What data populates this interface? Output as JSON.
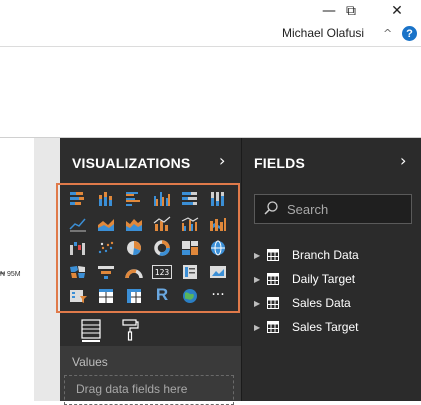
{
  "window": {
    "minimize_glyph": "—",
    "restore_glyph": "⧉",
    "close_glyph": "✕"
  },
  "account": {
    "user_name": "Michael Olafusi",
    "collapse_glyph": "^",
    "help_glyph": "?"
  },
  "canvas": {
    "value_label": "₦ 95M"
  },
  "visualizations": {
    "title": "VISUALIZATIONS",
    "expand_glyph": "›",
    "icons": [
      "stacked-bar-chart-icon",
      "stacked-column-chart-icon",
      "clustered-bar-chart-icon",
      "clustered-column-chart-icon",
      "100-stacked-bar-chart-icon",
      "100-stacked-column-chart-icon",
      "line-chart-icon",
      "area-chart-icon",
      "stacked-area-chart-icon",
      "line-and-stacked-column-chart-icon",
      "line-and-clustered-column-chart-icon",
      "ribbon-chart-icon",
      "waterfall-chart-icon",
      "scatter-chart-icon",
      "pie-chart-icon",
      "donut-chart-icon",
      "treemap-icon",
      "map-icon",
      "filled-map-icon",
      "funnel-icon",
      "gauge-icon",
      "card-icon",
      "multi-row-card-icon",
      "kpi-icon",
      "slicer-icon",
      "table-icon",
      "matrix-icon",
      "r-script-visual-icon",
      "arcgis-map-icon",
      "more-visuals-icon"
    ],
    "r_label": "R",
    "more_label": "···",
    "card_label": "123",
    "tabs": [
      "fields-tab-icon",
      "format-paint-roller-icon"
    ],
    "values_label": "Values",
    "drop_placeholder": "Drag data fields here",
    "accent_color": "#e07a4a"
  },
  "fields": {
    "title": "FIELDS",
    "expand_glyph": "›",
    "search_placeholder": "Search",
    "tables": [
      {
        "label": "Branch Data"
      },
      {
        "label": "Daily Target"
      },
      {
        "label": "Sales Data"
      },
      {
        "label": "Sales Target"
      }
    ]
  }
}
